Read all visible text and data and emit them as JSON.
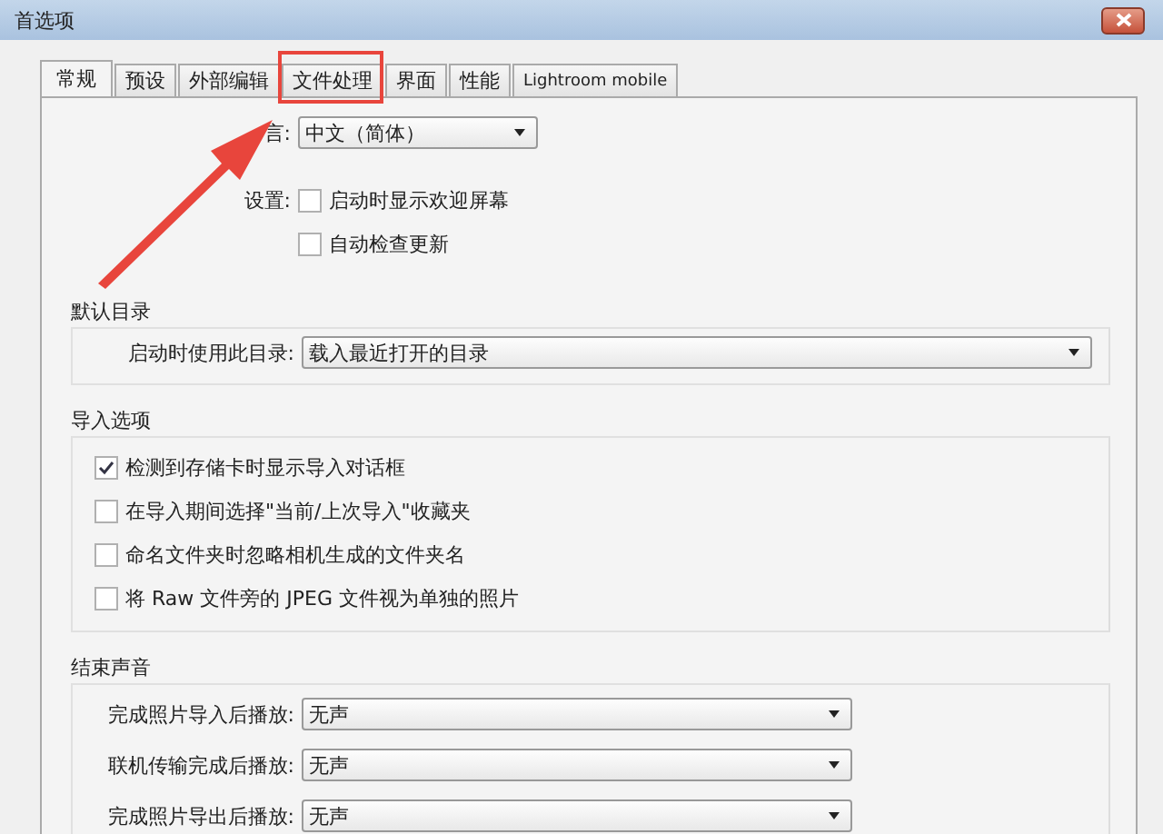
{
  "window": {
    "title": "首选项"
  },
  "tabs": [
    {
      "label": "常规",
      "selected": true
    },
    {
      "label": "预设",
      "selected": false
    },
    {
      "label": "外部编辑",
      "selected": false
    },
    {
      "label": "文件处理",
      "selected": false
    },
    {
      "label": "界面",
      "selected": false
    },
    {
      "label": "性能",
      "selected": false
    },
    {
      "label": "Lightroom mobile",
      "selected": false
    }
  ],
  "language": {
    "label": "言:",
    "value": "中文（简体）"
  },
  "settings": {
    "label": "设置:",
    "options": [
      {
        "label": "启动时显示欢迎屏幕",
        "checked": false
      },
      {
        "label": "自动检查更新",
        "checked": false
      }
    ]
  },
  "default_catalog": {
    "title": "默认目录",
    "label": "启动时使用此目录:",
    "value": "载入最近打开的目录"
  },
  "import_options": {
    "title": "导入选项",
    "options": [
      {
        "label": "检测到存储卡时显示导入对话框",
        "checked": true
      },
      {
        "label": "在导入期间选择\"当前/上次导入\"收藏夹",
        "checked": false
      },
      {
        "label": "命名文件夹时忽略相机生成的文件夹名",
        "checked": false
      },
      {
        "label": "将 Raw 文件旁的 JPEG 文件视为单独的照片",
        "checked": false
      }
    ]
  },
  "completion_sounds": {
    "title": "结束声音",
    "rows": [
      {
        "label": "完成照片导入后播放:",
        "value": "无声"
      },
      {
        "label": "联机传输完成后播放:",
        "value": "无声"
      },
      {
        "label": "完成照片导出后播放:",
        "value": "无声"
      }
    ]
  }
}
